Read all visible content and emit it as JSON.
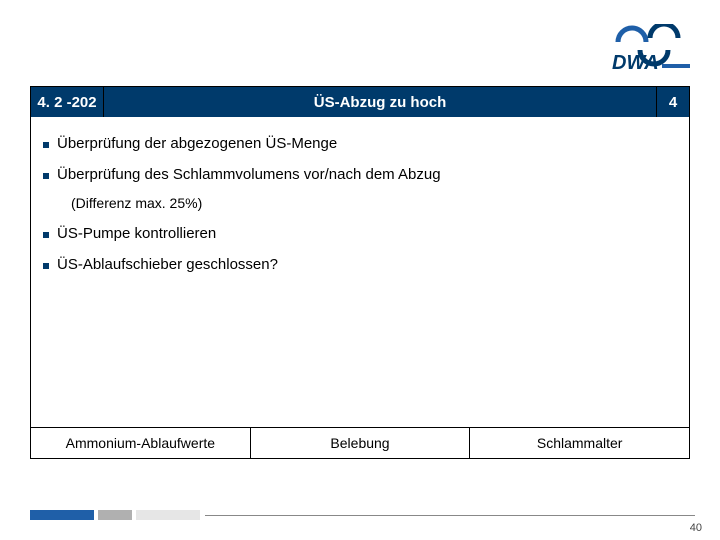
{
  "logo": {
    "text1": "DWA",
    "accent": "#1f5fa8",
    "dark": "#003a6b"
  },
  "header": {
    "code": "4. 2 -202",
    "title": "ÜS-Abzug zu hoch",
    "num": "4"
  },
  "bullets": [
    {
      "text": "Überprüfung der abgezogenen ÜS-Menge"
    },
    {
      "text": "Überprüfung des Schlammvolumens vor/nach dem Abzug",
      "sub": "(Differenz max. 25%)"
    },
    {
      "text": "ÜS-Pumpe kontrollieren"
    },
    {
      "text": "ÜS-Ablaufschieber geschlossen?"
    }
  ],
  "footer": [
    "Ammonium-Ablaufwerte",
    "Belebung",
    "Schlammalter"
  ],
  "page": "40"
}
